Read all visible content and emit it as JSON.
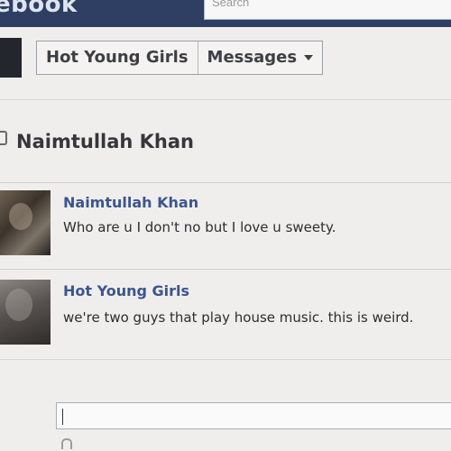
{
  "topbar": {
    "logo_text": "ebook",
    "search_placeholder": "Search"
  },
  "header": {
    "crumbs": [
      {
        "label": "Hot Young Girls"
      },
      {
        "label": "Messages"
      }
    ]
  },
  "thread": {
    "title": "Naimtullah Khan"
  },
  "messages": [
    {
      "sender": "Naimtullah Khan",
      "text": "Who are u I don't no but I love u sweety."
    },
    {
      "sender": "Hot Young Girls",
      "text": "we're two guys that play house music. this is weird."
    }
  ],
  "colors": {
    "topbar": "#2e3f63",
    "link": "#3b5590",
    "background": "#f0eeec"
  }
}
